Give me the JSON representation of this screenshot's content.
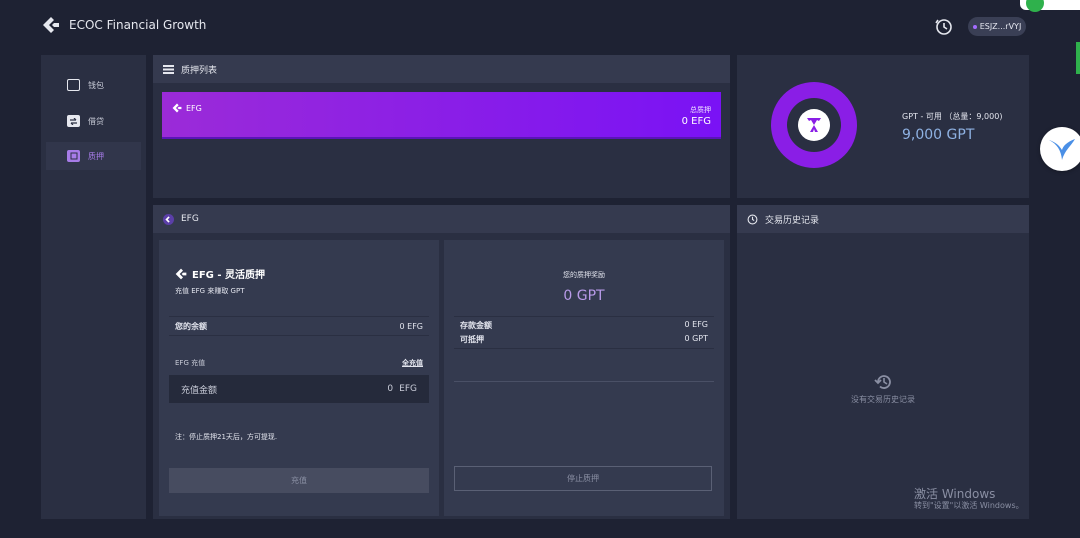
{
  "app": {
    "title": "ECOC Financial Growth"
  },
  "header": {
    "wallet_address": "ESJZ...rVYJ"
  },
  "sidebar": {
    "items": [
      {
        "label": "钱包"
      },
      {
        "label": "借贷"
      },
      {
        "label": "质押"
      }
    ]
  },
  "pledge_list": {
    "title": "质押列表",
    "card": {
      "token": "EFG",
      "total_label": "总质押",
      "total_value": "0 EFG"
    }
  },
  "gpt_summary": {
    "label": "GPT - 可用 （总量：9,000)",
    "value": "9,000 GPT",
    "available_fraction": 1.0
  },
  "efg_panel": {
    "title": "EFG",
    "left": {
      "heading": "EFG - 灵活质押",
      "subheading": "充值 EFG 来赚取 GPT",
      "balance_label": "您的余额",
      "balance_value": "0 EFG",
      "deposit_label": "EFG 充值",
      "deposit_all": "全充值",
      "input_placeholder": "充值金额",
      "input_value": "0",
      "input_unit": "EFG",
      "note": "注：停止质押21天后，方可提现.",
      "submit_label": "充值"
    },
    "right": {
      "reward_label": "您的质押奖励",
      "reward_value": "0 GPT",
      "deposit_amount_label": "存款金额",
      "deposit_amount_value": "0 EFG",
      "withdrawable_label": "可抵押",
      "withdrawable_value": "0 GPT",
      "stop_label": "停止质押"
    }
  },
  "history": {
    "title": "交易历史记录",
    "empty_text": "没有交易历史记录"
  },
  "os_watermark": {
    "line1": "激活 Windows",
    "line2": "转到\"设置\"以激活 Windows。"
  },
  "colors": {
    "background": "#1e2233",
    "panel": "#2a2f42",
    "panel_header": "#353a4f",
    "accent_purple": "#8a1ee6",
    "gpt_blue": "#8fb2e3",
    "reward_purple": "#b89ae8"
  }
}
